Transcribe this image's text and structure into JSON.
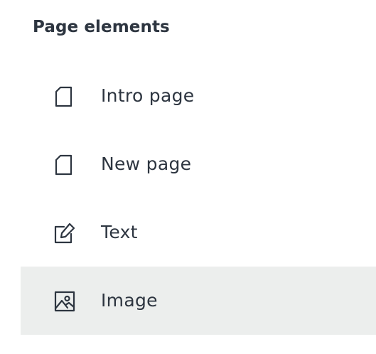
{
  "panel": {
    "title": "Page elements",
    "items": [
      {
        "label": "Intro page",
        "icon": "page-icon",
        "active": false
      },
      {
        "label": "New page",
        "icon": "page-icon",
        "active": false
      },
      {
        "label": "Text",
        "icon": "edit-text-icon",
        "active": false
      },
      {
        "label": "Image",
        "icon": "image-icon",
        "active": true
      }
    ],
    "colors": {
      "text": "#2d3540",
      "active_background": "#eceeed",
      "background": "#ffffff"
    }
  }
}
